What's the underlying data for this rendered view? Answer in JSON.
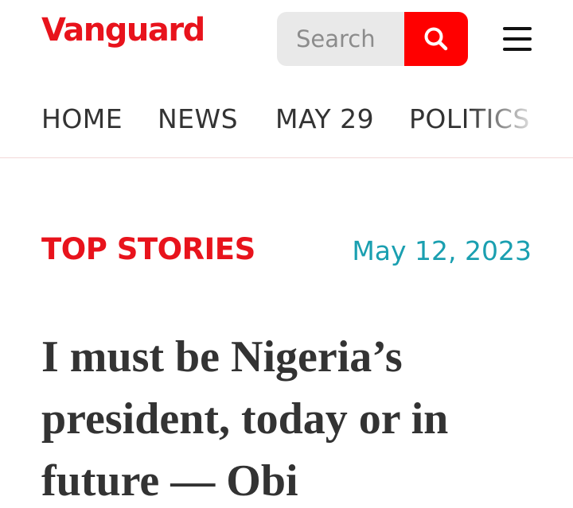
{
  "brand": {
    "name": "Vanguard",
    "color": "#e8131c"
  },
  "search": {
    "placeholder": "Search",
    "button_color": "#ff0000",
    "icon": "search-icon"
  },
  "menu": {
    "icon": "hamburger-menu-icon"
  },
  "nav": {
    "items": [
      {
        "label": "HOME"
      },
      {
        "label": "NEWS"
      },
      {
        "label": "MAY 29"
      },
      {
        "label": "POLITICS"
      }
    ]
  },
  "article": {
    "category": "TOP STORIES",
    "category_color": "#e8131c",
    "date": "May 12, 2023",
    "date_color": "#1a9fb0",
    "headline": "I must be Nigeria’s president, today or in future — Obi"
  }
}
